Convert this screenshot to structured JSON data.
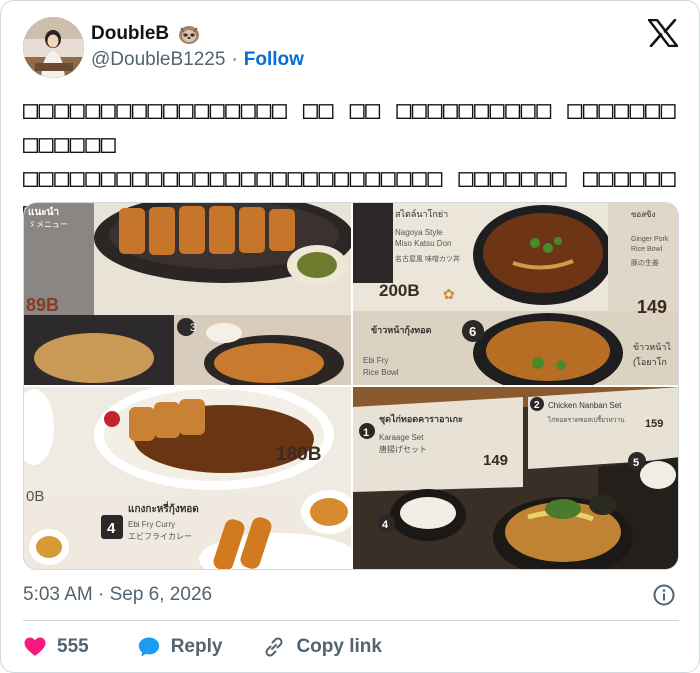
{
  "author": {
    "display_name": "DoubleB",
    "handle": "@DoubleB1225",
    "separator": "·",
    "follow_label": "Follow",
    "badge_icon": "sloth-emoji-icon"
  },
  "platform_icon": "x-logo-icon",
  "tweet": {
    "text": "□□□□□□□□□□□□□□□□□ □□ □□ □□□□□□□□□□ □□□□□□□ □□□□□□\n□□□□□□□□□□□□□□□□□□□□□□□□□□□ □□□□□□□ □□□□□□□□\n□□□ □□□□□□□□□□□ □□□□□□□□□□□□□□□□□□□□□□□□□"
  },
  "media": {
    "photo1": {
      "header_text": "แนะนำ",
      "sub_text": "ゞメニュー",
      "price_partial": "89B",
      "side_number": "3"
    },
    "photo2": {
      "thai_line": "สไตล์นาโกย่า",
      "name_en_1": "Nagoya Style",
      "name_en_2": "Miso Katsu Don",
      "name_jp": "名古屋風 味噌カツ丼",
      "price": "200B",
      "item6_number": "6",
      "item6_thai": "ข้าวหน้ากุ้งทอด",
      "item6_en_1": "Ebi Fry",
      "item6_en_2": "Rice Bowl",
      "right_thai": "ซอสขิง",
      "right_en_1": "Ginger Pork",
      "right_en_2": "Rice Bowl",
      "right_jp": "豚の生姜",
      "right_price": "149",
      "right_thai_2": "ข้าวหน้าไ",
      "right_thai_3": "(โอยาโก"
    },
    "photo3": {
      "price": "180B",
      "item_number": "4",
      "item_thai": "แกงกะหรี่กุ้งทอด",
      "item_en": "Ebi Fry Curry",
      "item_jp": "エビフライカレー",
      "left_partial": "0B"
    },
    "photo4": {
      "item1_number": "1",
      "item1_thai": "ชุดไก่ทอดคาราอาเกะ",
      "item1_en": "Karaage Set",
      "item1_jp": "唐揚げセット",
      "item1_price": "149",
      "item2_number": "2",
      "item2_en": "Chicken Nanban Set",
      "item2_thai": "ไก่ทอดราดซอสเปรี้ยวหวาน",
      "item2_price": "159",
      "item4_number": "4",
      "item5_number": "5"
    }
  },
  "meta": {
    "timestamp": "5:03 AM · Sep 6, 2026",
    "info_icon": "info-icon"
  },
  "actions": {
    "like_count": "555",
    "reply_label": "Reply",
    "copy_label": "Copy link"
  },
  "colors": {
    "text_primary": "#0f1419",
    "text_secondary": "#536471",
    "link_blue": "#006fd6",
    "like_pink": "#f91880",
    "reply_blue": "#1d9bf0",
    "border": "#cfd9de"
  }
}
